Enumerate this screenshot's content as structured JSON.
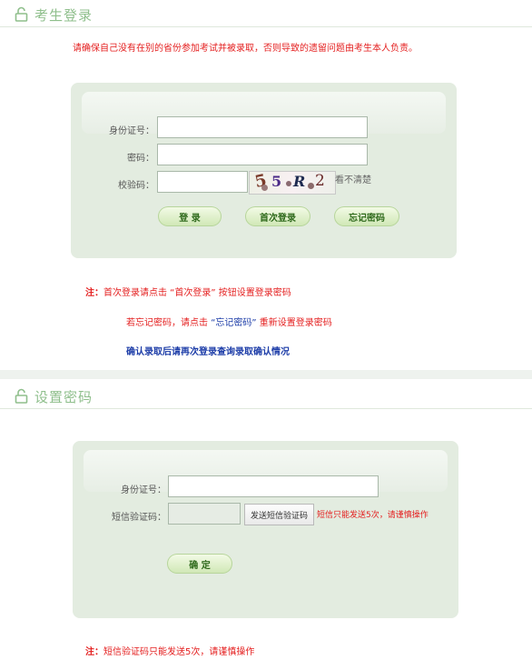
{
  "login": {
    "section_title": "考生登录",
    "warning": "请确保自己没有在别的省份参加考试并被录取，否则导致的遗留问题由考生本人负责。",
    "id_label": "身份证号：",
    "password_label": "密码：",
    "captcha_label": "校验码：",
    "captcha_chars": [
      "5",
      "5",
      "R",
      "2"
    ],
    "refresh_captcha": "看不清楚",
    "login_button": "登 录",
    "first_login_button": "首次登录",
    "forgot_button": "忘记密码",
    "note_prefix": "注：",
    "note_1": "首次登录请点击 “首次登录” 按钮设置登录密码",
    "note_2_before": "若忘记密码，请点击 ",
    "note_2_highlight": "“忘记密码”",
    "note_2_after": " 重新设置登录密码",
    "note_3": "确认录取后请再次登录查询录取确认情况"
  },
  "reset": {
    "section_title": "设置密码",
    "id_label": "身份证号：",
    "sms_label": "短信验证码：",
    "send_sms_button": "发送短信验证码",
    "sms_limit_hint": "短信只能发送5次，请谨慎操作",
    "confirm_button": "确 定",
    "note_prefix": "注：",
    "note": "短信验证码只能发送5次，请谨慎操作"
  },
  "colors": {
    "accent_green": "#8fbf8c",
    "panel_bg": "#e3ece0",
    "warning_red": "#e41e1e",
    "info_blue": "#1d3da8"
  }
}
